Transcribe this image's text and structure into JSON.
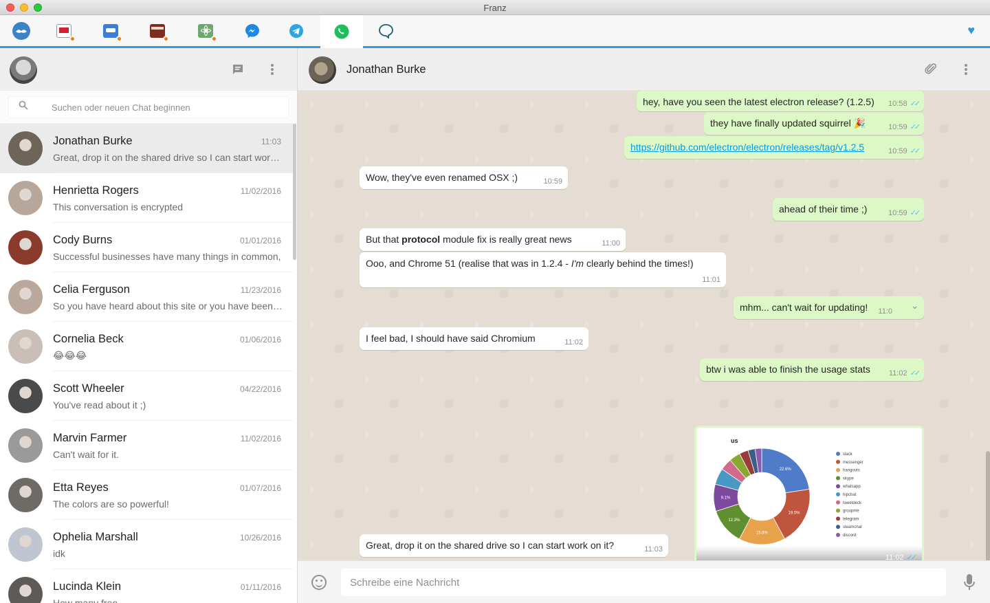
{
  "window": {
    "title": "Franz"
  },
  "services": [
    {
      "id": "franz",
      "name": "franz-icon"
    },
    {
      "id": "slack1",
      "name": "slack-workspace-icon"
    },
    {
      "id": "slack2",
      "name": "slack-workspace-icon"
    },
    {
      "id": "slack3",
      "name": "slack-workspace-icon"
    },
    {
      "id": "slack4",
      "name": "slack-workspace-icon"
    },
    {
      "id": "messenger",
      "name": "messenger-icon"
    },
    {
      "id": "telegram",
      "name": "telegram-icon"
    },
    {
      "id": "whatsapp",
      "name": "whatsapp-icon",
      "active": true
    },
    {
      "id": "hangouts",
      "name": "hangouts-icon"
    }
  ],
  "search": {
    "placeholder": "Suchen oder neuen Chat beginnen"
  },
  "chats": [
    {
      "name": "Jonathan Burke",
      "time": "11:03",
      "preview": "Great, drop it on the shared drive so I can start work on it?",
      "active": true,
      "color": "#6d6558"
    },
    {
      "name": "Henrietta Rogers",
      "time": "11/02/2016",
      "preview": "This conversation is encrypted",
      "color": "#b7a79a"
    },
    {
      "name": "Cody Burns",
      "time": "01/01/2016",
      "preview": "Successful businesses have many things in common,",
      "color": "#8a3b2c"
    },
    {
      "name": "Celia Ferguson",
      "time": "11/23/2016",
      "preview": "So you have heard about this site or you have been to it before.",
      "color": "#b9a89b"
    },
    {
      "name": "Cornelia Beck",
      "time": "01/06/2016",
      "preview": "😂😂😂",
      "color": "#c9bfb8"
    },
    {
      "name": "Scott Wheeler",
      "time": "04/22/2016",
      "preview": "You've read about it ;)",
      "color": "#4a4a4a"
    },
    {
      "name": "Marvin Farmer",
      "time": "11/02/2016",
      "preview": "Can't wait for it.",
      "color": "#9a9a9a"
    },
    {
      "name": "Etta Reyes",
      "time": "01/07/2016",
      "preview": "The colors are so powerful!",
      "color": "#6e6a66"
    },
    {
      "name": "Ophelia Marshall",
      "time": "10/26/2016",
      "preview": "idk",
      "color": "#bfc6cf"
    },
    {
      "name": "Lucinda Klein",
      "time": "01/11/2016",
      "preview": "How many free",
      "color": "#5d5a58"
    }
  ],
  "conversation": {
    "name": "Jonathan Burke",
    "messages": [
      {
        "dir": "out",
        "text": "hey, have you seen the latest electron release? (1.2.5)",
        "time": "10:58",
        "ticks": "✓✓"
      },
      {
        "dir": "out",
        "text": "they have finally updated squirrel 🎉",
        "time": "10:59",
        "ticks": "✓✓"
      },
      {
        "dir": "out",
        "link": "https://github.com/electron/electron/releases/tag/v1.2.5",
        "time": "10:59",
        "ticks": "✓✓"
      },
      {
        "dir": "in",
        "text": "Wow, they've even renamed OSX ;)",
        "time": "10:59"
      },
      {
        "dir": "out",
        "text": "ahead of their time ;)",
        "time": "10:59",
        "ticks": "✓✓"
      },
      {
        "dir": "in",
        "text_before": "But that ",
        "text_bold": "protocol",
        "text_after": " module fix is really great news",
        "time": "11:00"
      },
      {
        "dir": "in",
        "text_before": "Ooo, and Chrome 51 (realise that was in 1.2.4 - ",
        "text_italic": "I'm",
        "text_after": " clearly behind the times!)",
        "time": "11:01"
      },
      {
        "dir": "out",
        "text": "mhm... can't wait for updating!",
        "time": "11:0"
      },
      {
        "dir": "in",
        "text": "I feel bad, I should have said Chromium",
        "time": "11:02"
      },
      {
        "dir": "out",
        "text": "btw i was able to finish the usage stats",
        "time": "11:02",
        "ticks": "✓✓"
      },
      {
        "dir": "in",
        "text": "Great, drop it on the shared drive so I can start work on it?",
        "time": "11:03"
      }
    ],
    "image_message": {
      "time": "11:02",
      "ticks": "✓✓"
    }
  },
  "chart_data": {
    "type": "pie",
    "title": "us",
    "donut": true,
    "categories": [
      "slack",
      "messenger",
      "hangouts",
      "skype",
      "whatsapp",
      "hipchat",
      "tweetdeck",
      "groupme",
      "telegram",
      "steamchat",
      "discord"
    ],
    "values": [
      22.6,
      19.5,
      15.6,
      12.3,
      9.1,
      5.5,
      4.0,
      3.8,
      3.0,
      2.4,
      2.2
    ],
    "labels": [
      "22.6%",
      "19.5%",
      "15.6%",
      "12.3%",
      "9.1%",
      "",
      "",
      "",
      "",
      "",
      ""
    ],
    "colors": [
      "#4f7cc9",
      "#c0553e",
      "#e8a24c",
      "#5f8f2e",
      "#7d4a9e",
      "#4a98c4",
      "#d16a8a",
      "#88a830",
      "#9b3a3a",
      "#3a5f8a",
      "#8a5ab0"
    ],
    "legend": "right"
  },
  "composer": {
    "placeholder": "Schreibe eine Nachricht"
  }
}
